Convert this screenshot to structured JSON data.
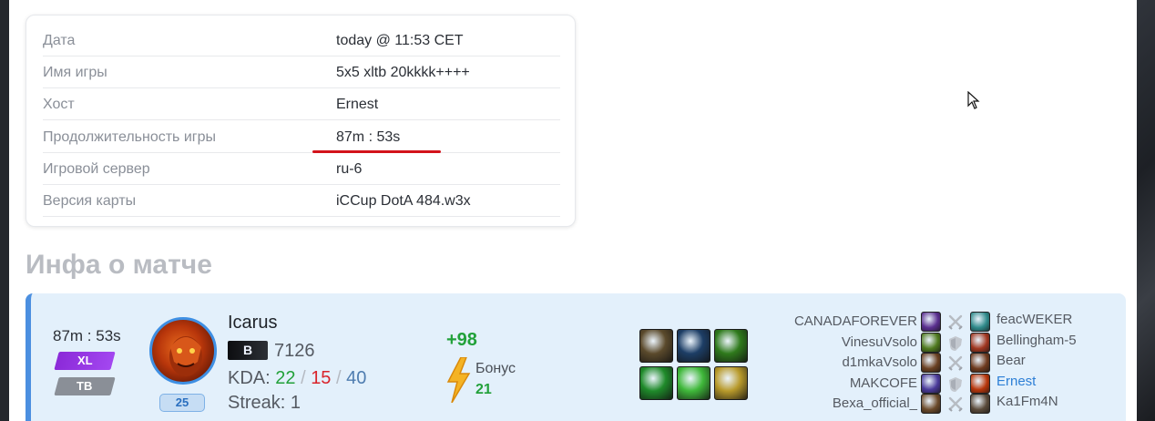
{
  "game_info": {
    "rows": [
      {
        "label": "Дата",
        "value": "today @ 11:53 CET"
      },
      {
        "label": "Имя игры",
        "value": "5x5 xltb 20kkkk++++"
      },
      {
        "label": "Хост",
        "value": "Ernest"
      },
      {
        "label": "Продолжительность игры",
        "value": "87m : 53s"
      },
      {
        "label": "Игровой сервер",
        "value": "ru-6"
      },
      {
        "label": "Версия карты",
        "value": "iCCup DotA 484.w3x"
      }
    ]
  },
  "match_section": {
    "title": "Инфа о матче"
  },
  "match": {
    "duration": "87m : 53s",
    "mode_badge": "XL",
    "type_badge": "TB",
    "hero_level": "25",
    "player_name": "Icarus",
    "rank_letter": "B",
    "rating": "7126",
    "kda_label": "KDA:",
    "kills": "22",
    "deaths": "15",
    "assists": "40",
    "kda_sep": "/",
    "streak_label": "Streak:",
    "streak": "1",
    "points": "+98",
    "bonus_label": "Бонус",
    "bonus_value": "21",
    "items": [
      {
        "icon": "monkey-item-icon",
        "color": "#5b4a2c"
      },
      {
        "icon": "orb-item-icon",
        "color": "#1d3e66"
      },
      {
        "icon": "claw-item-icon",
        "color": "#2f7a1c"
      },
      {
        "icon": "gloves-item-icon",
        "color": "#1f8a2a"
      },
      {
        "icon": "gem-item-icon",
        "color": "#3fb83a"
      },
      {
        "icon": "sword-item-icon",
        "color": "#b89a2b"
      }
    ]
  },
  "matchups": [
    {
      "left": "CANADAFOREVER",
      "left_color": "#5a2f8f",
      "icon": "crossed-swords-icon",
      "right": "feacWEKER",
      "right_color": "#2f8a8a"
    },
    {
      "left": "VinesuVsolo",
      "left_color": "#4f7a1f",
      "icon": "shield-icon",
      "right": "Bellingham-5",
      "right_color": "#a0361f"
    },
    {
      "left": "d1mkaVsolo",
      "left_color": "#6a4022",
      "icon": "crossed-swords-icon",
      "right": "Bear",
      "right_color": "#6e3a1e"
    },
    {
      "left": "MAKCOFE",
      "left_color": "#4a3a9a",
      "icon": "shield-icon",
      "right": "Ernest",
      "right_color": "#b8360b"
    },
    {
      "left": "Bexa_official_",
      "left_color": "#6b4a2a",
      "icon": "crossed-swords-icon",
      "right": "Ka1Fm4N",
      "right_color": "#5a4a3a"
    }
  ],
  "colors": {
    "accent": "#4b8fe0",
    "win_green": "#22a13a",
    "death_red": "#d9242b",
    "underline_red": "#d3131b",
    "card_bg": "#e3f0fb"
  }
}
